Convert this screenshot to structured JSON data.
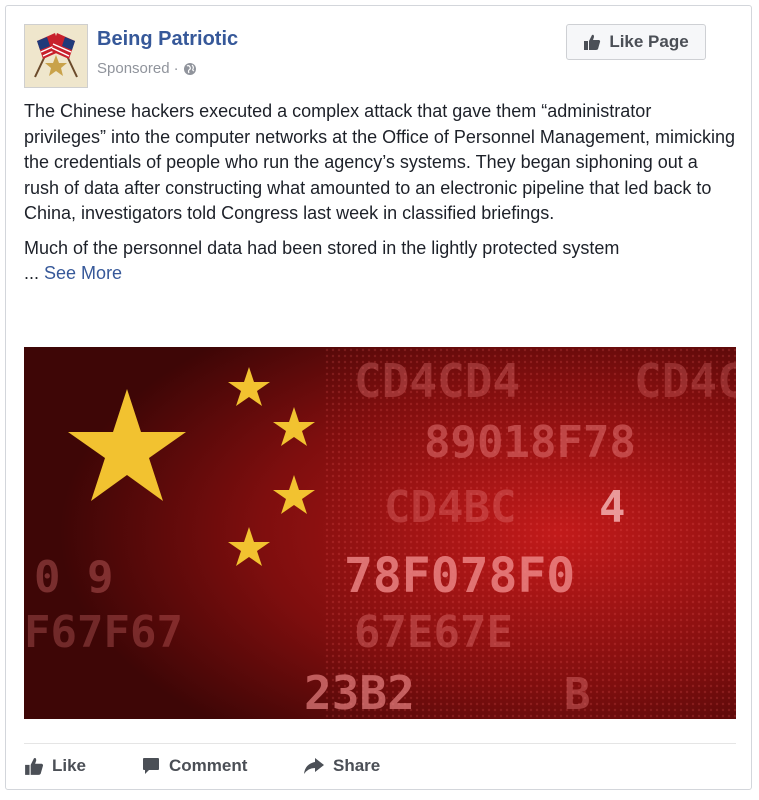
{
  "post": {
    "page_name": "Being Patriotic",
    "sponsored_label": "Sponsored",
    "sponsored_separator": "·",
    "icons": {
      "avatar": "flags-avatar",
      "globe": "globe-icon",
      "like_page": "thumbs-up-icon"
    },
    "like_page_label": "Like Page",
    "paragraphs": [
      "The Chinese hackers executed a complex attack that gave them “administrator privileges” into the computer networks at the Office of Personnel Management, mimicking the credentials of people who run the agency’s systems. They began siphoning out a rush of data after constructing what amounted to an electronic pipeline that led back to China, investigators told Congress last week in classified briefings.",
      "Much of the personnel data had been stored in the lightly protected system"
    ],
    "ellipsis": "...",
    "see_more_label": "See More",
    "image": {
      "description_icon": "china-flag-hex-code-image",
      "code_rows": [
        "CD4CD4 CD4C",
        "89018F78",
        "CD4BC 4",
        "78F078F0",
        "E67F67 E67E",
        "23B2 B"
      ],
      "colors": {
        "background": "#5a0a0a",
        "star": "#f2c230",
        "code": "#e87a7a"
      }
    }
  },
  "actions": [
    {
      "label": "Like",
      "icon": "thumbs-up-icon"
    },
    {
      "label": "Comment",
      "icon": "comment-icon"
    },
    {
      "label": "Share",
      "icon": "share-arrow-icon"
    }
  ],
  "colors": {
    "link": "#365899",
    "meta": "#90949c",
    "text": "#1d2129",
    "action": "#4b4f56"
  }
}
